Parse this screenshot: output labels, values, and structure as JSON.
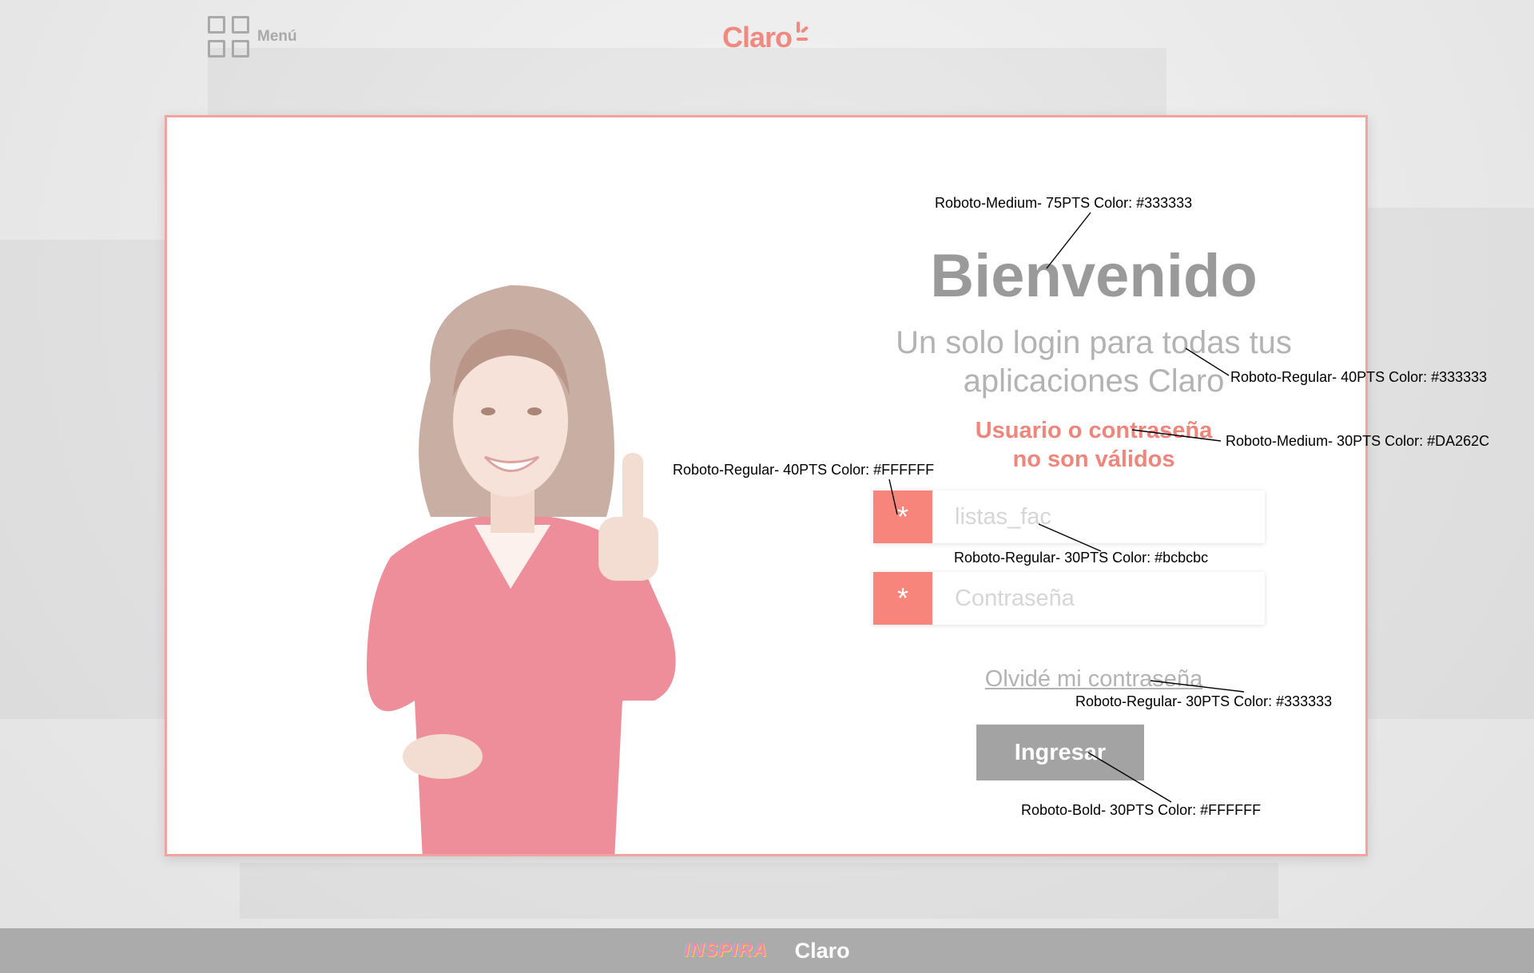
{
  "header": {
    "menu_label": "Menú",
    "logo": "Claro"
  },
  "login": {
    "title": "Bienvenido",
    "subtitle_line1": "Un solo login para todas tus",
    "subtitle_line2": "aplicaciones Claro",
    "error_line1": "Usuario o contraseña",
    "error_line2": "no son válidos",
    "field_icon": "*",
    "username_value": "listas_fac",
    "password_placeholder": "Contraseña",
    "forgot_link": "Olvidé mi contraseña",
    "submit_label": "Ingresar"
  },
  "annotations": {
    "title_spec": "Roboto-Medium- 75PTS Color: #333333",
    "subtitle_spec": "Roboto-Regular- 40PTS Color: #333333",
    "error_spec": "Roboto-Medium- 30PTS Color: #DA262C",
    "icon_spec": "Roboto-Regular- 40PTS Color: #FFFFFF",
    "input_spec": "Roboto-Regular- 30PTS Color: #bcbcbc",
    "forgot_spec": "Roboto-Regular- 30PTS Color: #333333",
    "button_spec": "Roboto-Bold- 30PTS Color: #FFFFFF"
  },
  "footer": {
    "inspira_logo": "INSPIRA",
    "claro_logo": "Claro"
  },
  "colors": {
    "accent": "#f7857b",
    "border": "#f2a39c",
    "button": "#a3a3a3",
    "footer": "#ababab"
  }
}
